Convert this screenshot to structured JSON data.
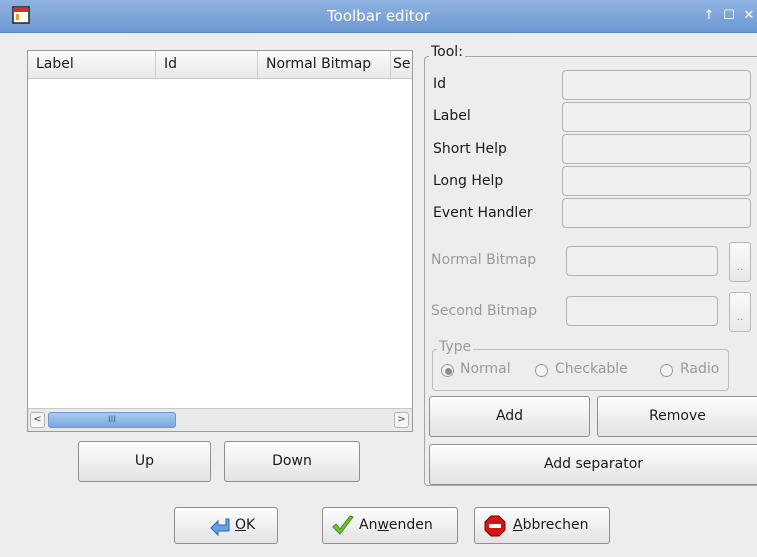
{
  "window": {
    "title": "Toolbar editor",
    "controls": {
      "help": "↑",
      "maximize": "☐",
      "close": "✕"
    }
  },
  "list": {
    "columns": [
      "Label",
      "Id",
      "Normal Bitmap",
      "Se"
    ],
    "rows": [],
    "scrollbar": {
      "left_arrow": "<",
      "right_arrow": ">",
      "grip": "III"
    }
  },
  "buttons": {
    "up": "Up",
    "down": "Down"
  },
  "tool": {
    "group_label": "Tool:",
    "fields": {
      "id": {
        "label": "Id",
        "value": ""
      },
      "label": {
        "label": "Label",
        "value": ""
      },
      "short_help": {
        "label": "Short Help",
        "value": ""
      },
      "long_help": {
        "label": "Long Help",
        "value": ""
      },
      "event_handler": {
        "label": "Event Handler",
        "value": ""
      }
    },
    "normal_bitmap": {
      "label": "Normal Bitmap",
      "value": "",
      "browse": ".."
    },
    "second_bitmap": {
      "label": "Second Bitmap",
      "value": "",
      "browse": ".."
    },
    "type": {
      "label": "Type",
      "options": [
        "Normal",
        "Checkable",
        "Radio"
      ],
      "selected": "Normal"
    },
    "add": "Add",
    "remove": "Remove",
    "add_separator": "Add separator"
  },
  "dialog_buttons": {
    "ok_prefix": "",
    "ok_mnemonic": "O",
    "ok_rest": "K",
    "apply_prefix": "An",
    "apply_mnemonic": "w",
    "apply_rest": "enden",
    "cancel_prefix": "",
    "cancel_mnemonic": "A",
    "cancel_rest": "bbrechen"
  },
  "colors": {
    "titlebar": "#7aa2d8",
    "scroll_thumb": "#8db4e6",
    "cancel_icon": "#d01010",
    "apply_check": "#5fb52a",
    "ok_arrow": "#3d78c9"
  }
}
